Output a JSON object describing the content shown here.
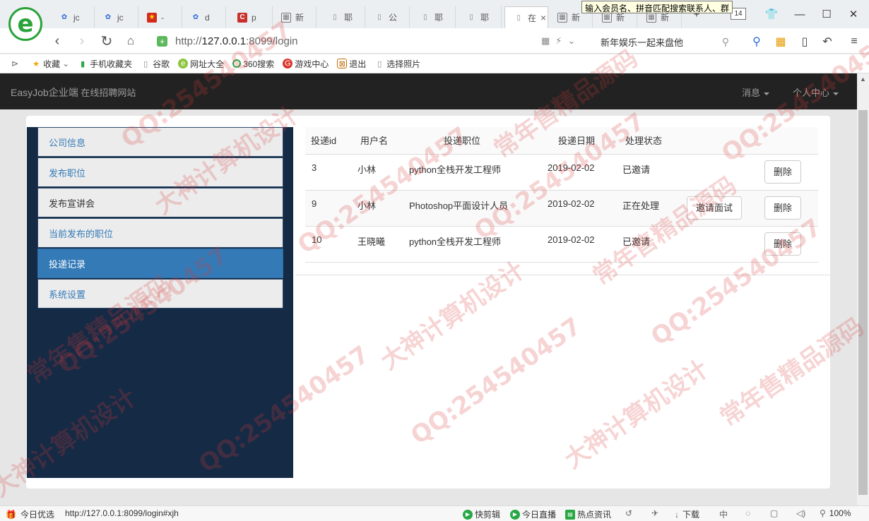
{
  "browser": {
    "tabs": [
      {
        "label": "jc",
        "icon": "paw-icon"
      },
      {
        "label": "jc",
        "icon": "paw-icon"
      },
      {
        "label": "-",
        "icon": "flag-icon"
      },
      {
        "label": "d",
        "icon": "paw-icon"
      },
      {
        "label": "p",
        "icon": "c-logo-icon"
      },
      {
        "label": "新",
        "icon": "grid-icon"
      },
      {
        "label": "耶",
        "icon": "page-icon"
      },
      {
        "label": "公",
        "icon": "page-icon"
      },
      {
        "label": "耶",
        "icon": "page-icon"
      },
      {
        "label": "耶",
        "icon": "page-icon"
      },
      {
        "label": "在",
        "icon": "page-icon"
      },
      {
        "label": "新",
        "icon": "grid-icon"
      },
      {
        "label": "新",
        "icon": "grid-icon"
      },
      {
        "label": "新",
        "icon": "grid-icon"
      }
    ],
    "tooltip": "输入会员名、拼音匹配搜索联系人、群",
    "tab_count": "14",
    "url_prefix": "http://",
    "url_host": "127.0.0.1",
    "url_rest": ":8099/login",
    "search_text": "新年娱乐一起来盘他",
    "bookmarks": [
      {
        "label": "收藏",
        "icon": "star-icon"
      },
      {
        "label": "手机收藏夹",
        "icon": "phone-icon"
      },
      {
        "label": "谷歌",
        "icon": "page-icon"
      },
      {
        "label": "网址大全",
        "icon": "globe-icon"
      },
      {
        "label": "360搜索",
        "icon": "search-360-icon"
      },
      {
        "label": "游戏中心",
        "icon": "game-icon"
      },
      {
        "label": "退出",
        "icon": "exit-icon"
      },
      {
        "label": "选择照片",
        "icon": "page-icon"
      }
    ]
  },
  "app": {
    "brand": "EasyJob企业端",
    "subtitle": "在线招聘网站",
    "menu_messages": "消息",
    "menu_personal": "个人中心"
  },
  "sidebar": {
    "items": [
      {
        "label": "公司信息"
      },
      {
        "label": "发布职位"
      },
      {
        "label": "发布宣讲会"
      },
      {
        "label": "当前发布的职位"
      },
      {
        "label": "投递记录"
      },
      {
        "label": "系统设置"
      }
    ]
  },
  "table": {
    "headers": [
      "投递id",
      "用户名",
      "投递职位",
      "投递日期",
      "处理状态"
    ],
    "rows": [
      {
        "id": "3",
        "user": "小林",
        "position": "python全栈开发工程师",
        "date": "2019-02-02",
        "status": "已邀请",
        "invite": "",
        "delete": "删除"
      },
      {
        "id": "9",
        "user": "小林",
        "position": "Photoshop平面设计人员",
        "date": "2019-02-02",
        "status": "正在处理",
        "invite": "邀请面试",
        "delete": "删除"
      },
      {
        "id": "10",
        "user": "王晓曦",
        "position": "python全栈开发工程师",
        "date": "2019-02-02",
        "status": "已邀请",
        "invite": "",
        "delete": "删除"
      }
    ]
  },
  "statusbar": {
    "left_label": "今日优选",
    "status_url": "http://127.0.0.1:8099/login#xjh",
    "items": [
      "快剪辑",
      "今日直播",
      "热点资讯"
    ],
    "download": "下载",
    "zoom": "100%"
  },
  "watermark": {
    "texts": [
      "QQ:254540457",
      "大神计算机设计",
      "常年售精品源码"
    ]
  }
}
